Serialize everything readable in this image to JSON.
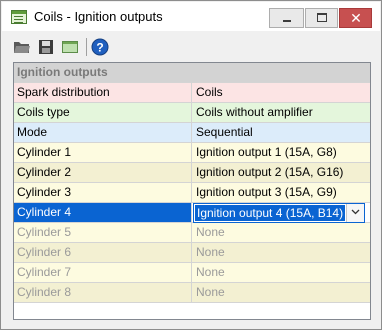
{
  "window": {
    "title": "Coils - Ignition outputs",
    "close_glyph": "✕"
  },
  "toolbar": {
    "icons": [
      "open-folder-icon",
      "save-icon",
      "panel-icon",
      "help-icon"
    ],
    "help_glyph": "?"
  },
  "grid": {
    "group_title": "Ignition outputs",
    "rows": [
      {
        "name": "Spark distribution",
        "value": "Coils"
      },
      {
        "name": "Coils type",
        "value": "Coils without amplifier"
      },
      {
        "name": "Mode",
        "value": "Sequential"
      },
      {
        "name": "Cylinder 1",
        "value": "Ignition output 1 (15A, G8)"
      },
      {
        "name": "Cylinder 2",
        "value": "Ignition output 2 (15A, G16)"
      },
      {
        "name": "Cylinder 3",
        "value": "Ignition output 3 (15A, G9)"
      },
      {
        "name": "Cylinder 4",
        "value": "Ignition output 4 (15A, B14)"
      },
      {
        "name": "Cylinder 5",
        "value": "None"
      },
      {
        "name": "Cylinder 6",
        "value": "None"
      },
      {
        "name": "Cylinder 7",
        "value": "None"
      },
      {
        "name": "Cylinder 8",
        "value": "None"
      }
    ]
  },
  "colors": {
    "selection": "#0a64d2",
    "close_button": "#c75050",
    "group_header": "#d3d3d3"
  }
}
